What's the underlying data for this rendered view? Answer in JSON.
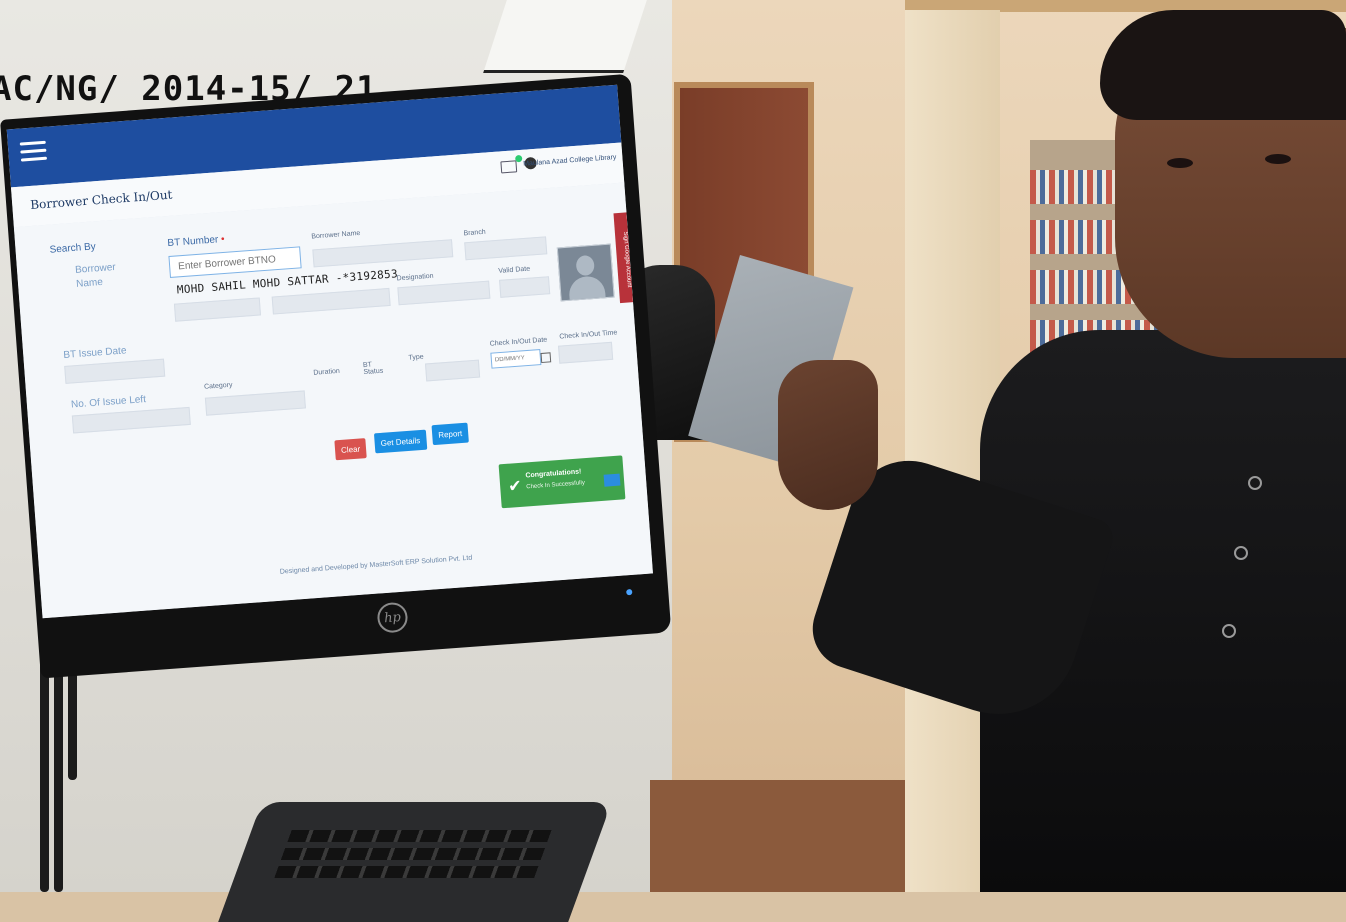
{
  "tape_label": "AC/NG/ 2014-15/ 21",
  "app": {
    "page_title": "Borrower Check In/Out",
    "user_name": "Maulana Azad College Library",
    "side_tab": "Sign Google Account",
    "monitor_brand": "hp"
  },
  "form": {
    "search_by_label": "Search By",
    "search_options": [
      "Borrower",
      "Name"
    ],
    "bt_number_label": "BT Number",
    "bt_number_placeholder": "Enter Borrower BTNO",
    "borrower_name_label": "Borrower Name",
    "branch_label": "Branch",
    "result_name": "MOHD SAHIL MOHD SATTAR -*3192853",
    "designation_label": "Designation",
    "valid_date_label": "Valid Date",
    "bt_issue_date_label": "BT Issue Date",
    "no_of_issue_left_label": "No. Of Issue Left",
    "category_label": "Category",
    "duration_label": "Duration",
    "bt_status_label": "BT Status",
    "type_label": "Type",
    "check_date_label": "Check In/Out Date",
    "check_date_placeholder": "DD/MM/YY",
    "check_time_label": "Check In/Out Time"
  },
  "buttons": {
    "clear": "Clear",
    "get_details": "Get Details",
    "report": "Report"
  },
  "toast": {
    "title": "Congratulations!",
    "message": "Check In Successfully"
  },
  "footer": "Designed and Developed by MasterSoft ERP Solution Pvt. Ltd"
}
